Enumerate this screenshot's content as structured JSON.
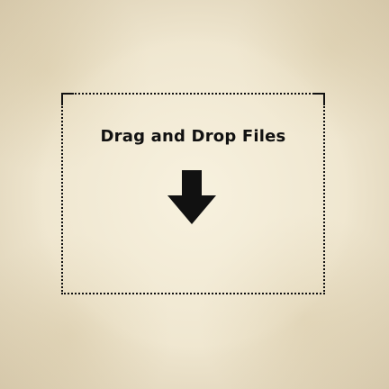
{
  "drop_zone": {
    "title": "Drag and Drop Files",
    "icon": "arrow-down-icon"
  },
  "colors": {
    "background": "#efe6cf",
    "ink": "#111111"
  }
}
